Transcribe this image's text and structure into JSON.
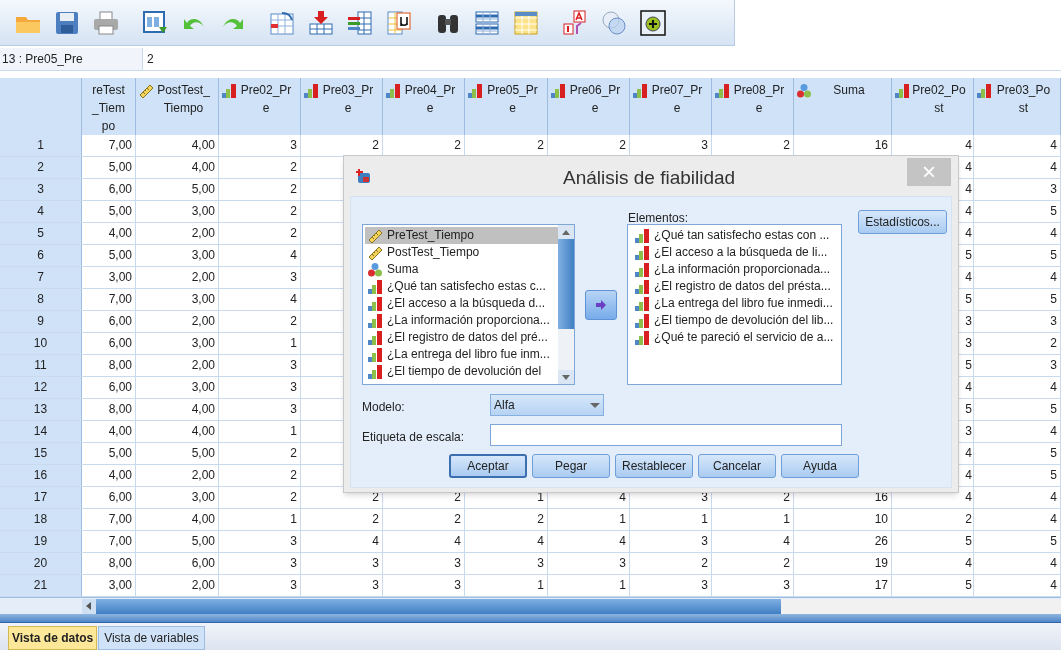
{
  "cell_editor": {
    "cell_name": "13 : Pre05_Pre",
    "value": "2"
  },
  "grid": {
    "columns": [
      {
        "label": "reTest_Tiempo"
      },
      {
        "label": "PostTest_Tiempo",
        "kind": "scale"
      },
      {
        "label": "Pre02_Pre",
        "kind": "ordinal"
      },
      {
        "label": "Pre03_Pre",
        "kind": "ordinal"
      },
      {
        "label": "Pre04_Pre",
        "kind": "ordinal"
      },
      {
        "label": "Pre05_Pre",
        "kind": "ordinal"
      },
      {
        "label": "Pre06_Pre",
        "kind": "ordinal"
      },
      {
        "label": "Pre07_Pre",
        "kind": "ordinal"
      },
      {
        "label": "Pre08_Pre",
        "kind": "ordinal"
      },
      {
        "label": "Suma",
        "kind": "nominal"
      },
      {
        "label": "Pre02_Post",
        "kind": "ordinal"
      },
      {
        "label": "Pre03_Post",
        "kind": "ordinal"
      }
    ],
    "rows": [
      {
        "number": "1",
        "cells": [
          "7,00",
          "4,00",
          "3",
          "2",
          "2",
          "2",
          "2",
          "3",
          "2",
          "16",
          "4",
          "4"
        ]
      },
      {
        "number": "2",
        "cells": [
          "5,00",
          "4,00",
          "2",
          null,
          null,
          null,
          null,
          null,
          null,
          null,
          "4",
          "4"
        ]
      },
      {
        "number": "3",
        "cells": [
          "6,00",
          "5,00",
          "2",
          null,
          null,
          null,
          null,
          null,
          null,
          null,
          "4",
          "3"
        ]
      },
      {
        "number": "4",
        "cells": [
          "5,00",
          "3,00",
          "2",
          null,
          null,
          null,
          null,
          null,
          null,
          null,
          "4",
          "5"
        ]
      },
      {
        "number": "5",
        "cells": [
          "4,00",
          "2,00",
          "2",
          null,
          null,
          null,
          null,
          null,
          null,
          null,
          "4",
          "4"
        ]
      },
      {
        "number": "6",
        "cells": [
          "5,00",
          "3,00",
          "4",
          null,
          null,
          null,
          null,
          null,
          null,
          null,
          "5",
          "5"
        ]
      },
      {
        "number": "7",
        "cells": [
          "3,00",
          "2,00",
          "3",
          null,
          null,
          null,
          null,
          null,
          null,
          null,
          "4",
          "4"
        ]
      },
      {
        "number": "8",
        "cells": [
          "7,00",
          "3,00",
          "4",
          null,
          null,
          null,
          null,
          null,
          null,
          null,
          "5",
          "5"
        ]
      },
      {
        "number": "9",
        "cells": [
          "6,00",
          "2,00",
          "2",
          null,
          null,
          null,
          null,
          null,
          null,
          null,
          "3",
          "3"
        ]
      },
      {
        "number": "10",
        "cells": [
          "6,00",
          "3,00",
          "1",
          null,
          null,
          null,
          null,
          null,
          null,
          null,
          "3",
          "2"
        ]
      },
      {
        "number": "11",
        "cells": [
          "8,00",
          "2,00",
          "3",
          null,
          null,
          null,
          null,
          null,
          null,
          null,
          "5",
          "3"
        ]
      },
      {
        "number": "12",
        "cells": [
          "6,00",
          "3,00",
          "3",
          null,
          null,
          null,
          null,
          null,
          null,
          null,
          "4",
          "4"
        ]
      },
      {
        "number": "13",
        "cells": [
          "8,00",
          "4,00",
          "3",
          null,
          null,
          null,
          null,
          null,
          null,
          null,
          "5",
          "5"
        ]
      },
      {
        "number": "14",
        "cells": [
          "4,00",
          "4,00",
          "1",
          null,
          null,
          null,
          null,
          null,
          null,
          null,
          "3",
          "4"
        ]
      },
      {
        "number": "15",
        "cells": [
          "5,00",
          "5,00",
          "2",
          null,
          null,
          null,
          null,
          null,
          null,
          null,
          "4",
          "5"
        ]
      },
      {
        "number": "16",
        "cells": [
          "4,00",
          "2,00",
          "2",
          null,
          null,
          null,
          null,
          null,
          null,
          null,
          "4",
          "5"
        ]
      },
      {
        "number": "17",
        "cells": [
          "6,00",
          "3,00",
          "2",
          "2",
          "2",
          "1",
          "4",
          "3",
          "2",
          "16",
          "4",
          "4"
        ]
      },
      {
        "number": "18",
        "cells": [
          "7,00",
          "4,00",
          "1",
          "2",
          "2",
          "2",
          "1",
          "1",
          "1",
          "10",
          "2",
          "4"
        ]
      },
      {
        "number": "19",
        "cells": [
          "7,00",
          "5,00",
          "3",
          "4",
          "4",
          "4",
          "4",
          "3",
          "4",
          "26",
          "5",
          "5"
        ]
      },
      {
        "number": "20",
        "cells": [
          "8,00",
          "6,00",
          "3",
          "3",
          "3",
          "3",
          "3",
          "2",
          "2",
          "19",
          "4",
          "4"
        ]
      },
      {
        "number": "21",
        "cells": [
          "3,00",
          "2,00",
          "3",
          "3",
          "3",
          "1",
          "1",
          "3",
          "3",
          "17",
          "5",
          "4"
        ]
      }
    ]
  },
  "dialog": {
    "title": "Análisis de fiabilidad",
    "close": "×",
    "variables": [
      {
        "label": "PreTest_Tiempo",
        "kind": "scale",
        "selected": true
      },
      {
        "label": "PostTest_Tiempo",
        "kind": "scale",
        "selected": false
      },
      {
        "label": "Suma",
        "kind": "nominal",
        "selected": false
      },
      {
        "label": "¿Qué tan satisfecho estas c...",
        "kind": "ordinal",
        "selected": false
      },
      {
        "label": "¿El acceso a la búsqueda d...",
        "kind": "ordinal",
        "selected": false
      },
      {
        "label": "¿La información proporciona...",
        "kind": "ordinal",
        "selected": false
      },
      {
        "label": "¿El registro de datos del pré...",
        "kind": "ordinal",
        "selected": false
      },
      {
        "label": "¿La entrega del libro fue inm...",
        "kind": "ordinal",
        "selected": false
      },
      {
        "label": "¿El tiempo de devolución del",
        "kind": "ordinal",
        "selected": false
      }
    ],
    "items_label": "Elementos:",
    "items": [
      {
        "label": "¿Qué tan satisfecho estas con ...",
        "kind": "ordinal",
        "selected": false
      },
      {
        "label": "¿El acceso a la búsqueda de li...",
        "kind": "ordinal",
        "selected": false
      },
      {
        "label": "¿La información proporcionada...",
        "kind": "ordinal",
        "selected": false
      },
      {
        "label": "¿El registro de datos del présta...",
        "kind": "ordinal",
        "selected": false
      },
      {
        "label": "¿La entrega del libro fue inmedi...",
        "kind": "ordinal",
        "selected": false
      },
      {
        "label": "¿El tiempo de devolución del lib...",
        "kind": "ordinal",
        "selected": false
      },
      {
        "label": "¿Qué te pareció el servicio de a...",
        "kind": "ordinal",
        "selected": false
      }
    ],
    "statistics_button": "Estadísticos...",
    "model_label": "Modelo:",
    "model_value": "Alfa",
    "scale_label": "Etiqueta de escala:",
    "buttons": [
      "Aceptar",
      "Pegar",
      "Restablecer",
      "Cancelar",
      "Ayuda"
    ]
  },
  "view_tabs": [
    {
      "label": "Vista de datos",
      "selected": true
    },
    {
      "label": "Vista de variables",
      "selected": false
    }
  ]
}
